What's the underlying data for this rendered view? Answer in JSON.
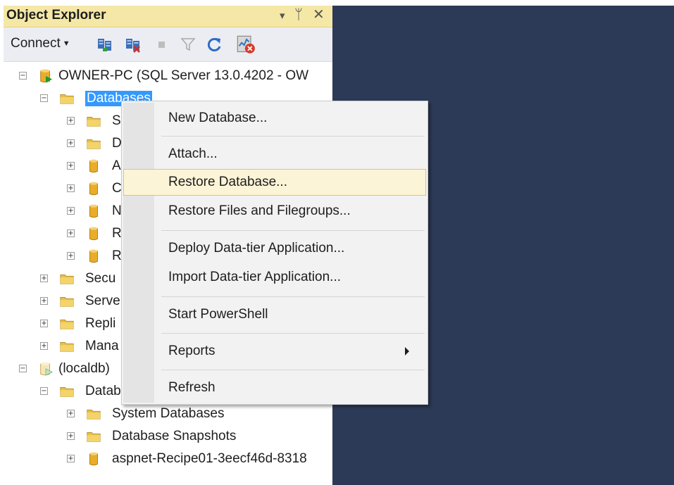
{
  "object_explorer": {
    "title": "Object Explorer",
    "title_buttons": [
      "▾",
      "ᛘ",
      "✕"
    ],
    "toolbar": {
      "connect_label": "Connect",
      "icons": [
        "connect-server-icon",
        "disconnect-server-icon",
        "stop-icon",
        "filter-icon",
        "refresh-icon",
        "activity-monitor-icon"
      ]
    },
    "tree": [
      {
        "label": "OWNER-PC (SQL Server 13.0.4202 - OW",
        "expander": "−",
        "icon": "server-icon"
      },
      {
        "label": "Databases",
        "expander": "−",
        "icon": "folder-icon",
        "selected": true
      },
      {
        "label": "S",
        "expander": "+",
        "icon": "folder-icon"
      },
      {
        "label": "D",
        "expander": "+",
        "icon": "folder-icon"
      },
      {
        "label": "A",
        "expander": "+",
        "icon": "database-icon"
      },
      {
        "label": "C",
        "expander": "+",
        "icon": "database-icon"
      },
      {
        "label": "N",
        "expander": "+",
        "icon": "database-icon"
      },
      {
        "label": "R",
        "expander": "+",
        "icon": "database-icon"
      },
      {
        "label": "R",
        "expander": "+",
        "icon": "database-icon"
      },
      {
        "label": "Secu",
        "expander": "+",
        "icon": "folder-icon"
      },
      {
        "label": "Serve",
        "expander": "+",
        "icon": "folder-icon"
      },
      {
        "label": "Repli",
        "expander": "+",
        "icon": "folder-icon"
      },
      {
        "label": "Mana",
        "expander": "+",
        "icon": "folder-icon"
      },
      {
        "label": "(localdb)",
        "expander": "−",
        "icon": "server-icon"
      },
      {
        "label": "Databases",
        "expander": "−",
        "icon": "folder-icon"
      },
      {
        "label": "System Databases",
        "expander": "+",
        "icon": "folder-icon"
      },
      {
        "label": "Database Snapshots",
        "expander": "+",
        "icon": "folder-icon"
      },
      {
        "label": "aspnet-Recipe01-3eecf46d-8318",
        "expander": "+",
        "icon": "database-icon"
      }
    ]
  },
  "context_menu": {
    "items": [
      {
        "label": "New Database..."
      },
      {
        "label": "Attach..."
      },
      {
        "label": "Restore Database...",
        "highlighted": true
      },
      {
        "label": "Restore Files and Filegroups..."
      },
      {
        "label": "Deploy Data-tier Application..."
      },
      {
        "label": "Import Data-tier Application..."
      },
      {
        "label": "Start PowerShell"
      },
      {
        "label": "Reports",
        "submenu_icon": "chevron-right-icon"
      },
      {
        "label": "Refresh"
      }
    ]
  },
  "colors": {
    "title_bar": "#f5e8a6",
    "selection": "#3399ff",
    "menu_highlight": "#fcf4d7",
    "menu_highlight_border": "#e5c365",
    "desktop": "#2d3a57",
    "folder": "#e8c04a",
    "database": "#e8ad2a"
  }
}
